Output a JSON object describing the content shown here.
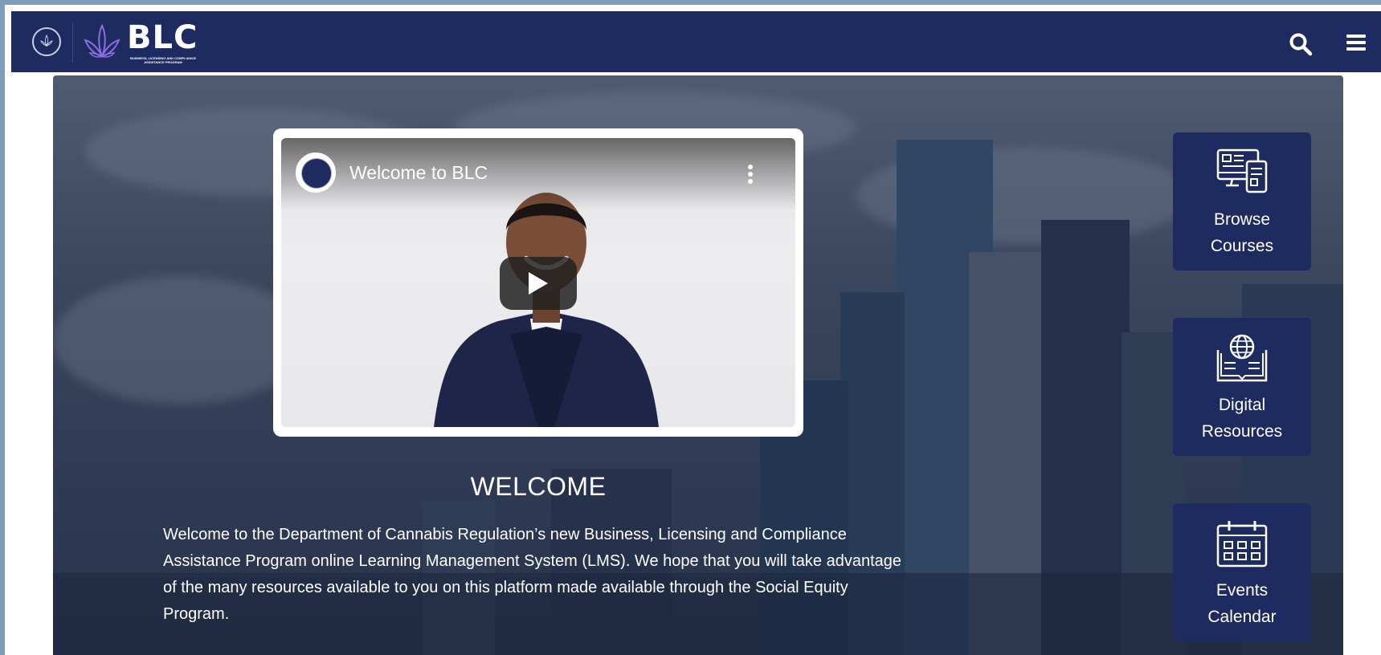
{
  "header": {
    "brand": "BLC",
    "brand_subtitle": "Business, Licensing and Compliance Assistance Program"
  },
  "icons": {
    "search": "search-icon",
    "menu": "menu-icon",
    "play": "play-icon",
    "more": "more-vert-icon"
  },
  "video": {
    "title": "Welcome to BLC"
  },
  "welcome": {
    "heading": "WELCOME",
    "body": "Welcome to the Department of Cannabis Regulation’s new Business, Licensing and Compliance Assistance Program online Learning Management System (LMS). We hope that you will take advantage of the many resources available to you on this platform made available through the Social Equity Program."
  },
  "tiles": [
    {
      "line1": "Browse",
      "line2": "Courses",
      "icon": "computer-devices-icon"
    },
    {
      "line1": "Digital",
      "line2": "Resources",
      "icon": "globe-book-icon"
    },
    {
      "line1": "Events",
      "line2": "Calendar",
      "icon": "calendar-icon"
    }
  ],
  "colors": {
    "navy": "#1e2b61",
    "frame": "#7f9dbd",
    "text_light": "#ffffff"
  }
}
